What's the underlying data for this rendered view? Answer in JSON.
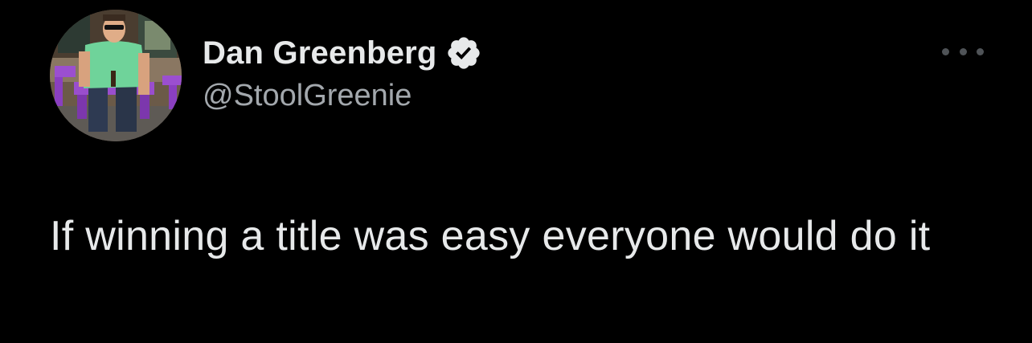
{
  "tweet": {
    "author": {
      "display_name": "Dan Greenberg",
      "handle": "@StoolGreenie",
      "verified": true,
      "avatar_icon": "profile-photo"
    },
    "more_icon": "ellipsis-icon",
    "text": "If winning a title was easy everyone would do it"
  },
  "colors": {
    "background": "#000000",
    "primary_text": "#e7e9ea",
    "secondary_text": "#a3a8ad",
    "verified_badge": "#e7e9ea"
  }
}
